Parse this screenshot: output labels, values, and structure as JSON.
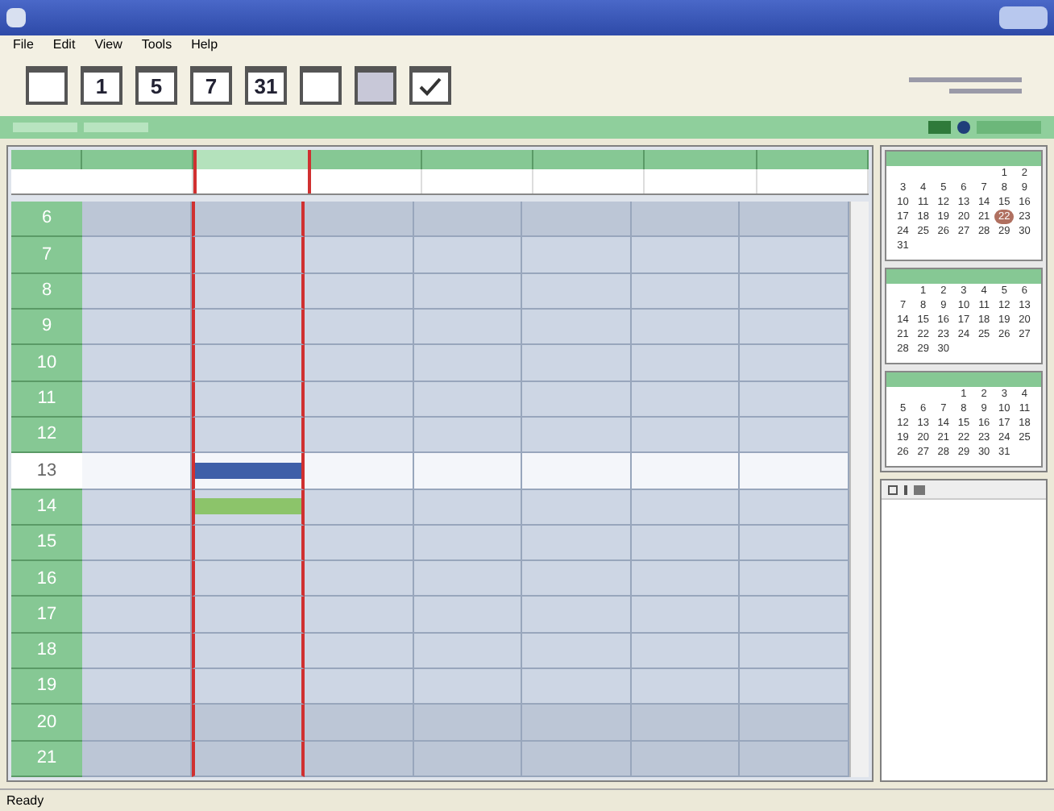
{
  "menu": [
    {
      "label": "File"
    },
    {
      "label": "Edit"
    },
    {
      "label": "View"
    },
    {
      "label": "Tools"
    },
    {
      "label": "Help"
    }
  ],
  "toolbar": [
    {
      "kind": "blank"
    },
    {
      "kind": "number",
      "label": "1"
    },
    {
      "kind": "number",
      "label": "5"
    },
    {
      "kind": "number",
      "label": "7"
    },
    {
      "kind": "number",
      "label": "31"
    },
    {
      "kind": "blank"
    },
    {
      "kind": "shaded"
    },
    {
      "kind": "check"
    }
  ],
  "day_columns": [
    {
      "selected": false
    },
    {
      "selected": true
    },
    {
      "selected": false
    },
    {
      "selected": false
    },
    {
      "selected": false
    },
    {
      "selected": false
    },
    {
      "selected": false
    }
  ],
  "hours": [
    {
      "label": "6",
      "current": false,
      "cells": [
        {
          "kind": "empty"
        },
        {
          "kind": "empty"
        },
        {
          "kind": "empty"
        },
        {
          "kind": "empty"
        },
        {
          "kind": "empty"
        },
        {
          "kind": "empty"
        },
        {
          "kind": "empty"
        }
      ]
    },
    {
      "label": "7",
      "current": false,
      "cells": [
        {
          "kind": "empty"
        },
        {
          "kind": "empty"
        },
        {
          "kind": "empty"
        },
        {
          "kind": "empty"
        },
        {
          "kind": "empty"
        },
        {
          "kind": "empty"
        },
        {
          "kind": "empty"
        }
      ]
    },
    {
      "label": "8",
      "current": false,
      "cells": [
        {
          "kind": "empty"
        },
        {
          "kind": "empty"
        },
        {
          "kind": "empty"
        },
        {
          "kind": "empty"
        },
        {
          "kind": "empty"
        },
        {
          "kind": "empty"
        },
        {
          "kind": "empty"
        }
      ]
    },
    {
      "label": "9",
      "current": false,
      "cells": [
        {
          "kind": "empty"
        },
        {
          "kind": "empty"
        },
        {
          "kind": "empty"
        },
        {
          "kind": "empty"
        },
        {
          "kind": "empty"
        },
        {
          "kind": "empty"
        },
        {
          "kind": "empty"
        }
      ]
    },
    {
      "label": "10",
      "current": false,
      "cells": [
        {
          "kind": "empty"
        },
        {
          "kind": "empty"
        },
        {
          "kind": "empty"
        },
        {
          "kind": "empty"
        },
        {
          "kind": "empty"
        },
        {
          "kind": "empty"
        },
        {
          "kind": "empty"
        }
      ]
    },
    {
      "label": "11",
      "current": false,
      "cells": [
        {
          "kind": "empty"
        },
        {
          "kind": "empty"
        },
        {
          "kind": "empty"
        },
        {
          "kind": "empty"
        },
        {
          "kind": "empty"
        },
        {
          "kind": "empty"
        },
        {
          "kind": "empty"
        }
      ]
    },
    {
      "label": "12",
      "current": false,
      "cells": [
        {
          "kind": "empty"
        },
        {
          "kind": "empty"
        },
        {
          "kind": "empty"
        },
        {
          "kind": "empty"
        },
        {
          "kind": "empty"
        },
        {
          "kind": "empty"
        },
        {
          "kind": "empty"
        }
      ]
    },
    {
      "label": "13",
      "current": true,
      "cells": [
        {
          "kind": "empty"
        },
        {
          "kind": "event",
          "color": "#3f5fa8"
        },
        {
          "kind": "empty"
        },
        {
          "kind": "empty"
        },
        {
          "kind": "empty"
        },
        {
          "kind": "empty"
        },
        {
          "kind": "empty"
        }
      ]
    },
    {
      "label": "14",
      "current": false,
      "cells": [
        {
          "kind": "empty"
        },
        {
          "kind": "event",
          "color": "#8cc46a"
        },
        {
          "kind": "empty"
        },
        {
          "kind": "empty"
        },
        {
          "kind": "empty"
        },
        {
          "kind": "empty"
        },
        {
          "kind": "empty"
        }
      ]
    },
    {
      "label": "15",
      "current": false,
      "cells": [
        {
          "kind": "empty"
        },
        {
          "kind": "empty"
        },
        {
          "kind": "empty"
        },
        {
          "kind": "empty"
        },
        {
          "kind": "empty"
        },
        {
          "kind": "empty"
        },
        {
          "kind": "empty"
        }
      ]
    },
    {
      "label": "16",
      "current": false,
      "cells": [
        {
          "kind": "empty"
        },
        {
          "kind": "empty"
        },
        {
          "kind": "empty"
        },
        {
          "kind": "empty"
        },
        {
          "kind": "empty"
        },
        {
          "kind": "empty"
        },
        {
          "kind": "empty"
        }
      ]
    },
    {
      "label": "17",
      "current": false,
      "cells": [
        {
          "kind": "empty"
        },
        {
          "kind": "empty"
        },
        {
          "kind": "empty"
        },
        {
          "kind": "empty"
        },
        {
          "kind": "empty"
        },
        {
          "kind": "empty"
        },
        {
          "kind": "empty"
        }
      ]
    },
    {
      "label": "18",
      "current": false,
      "cells": [
        {
          "kind": "empty"
        },
        {
          "kind": "empty"
        },
        {
          "kind": "empty"
        },
        {
          "kind": "empty"
        },
        {
          "kind": "empty"
        },
        {
          "kind": "empty"
        },
        {
          "kind": "empty"
        }
      ]
    },
    {
      "label": "19",
      "current": false,
      "cells": [
        {
          "kind": "empty"
        },
        {
          "kind": "empty"
        },
        {
          "kind": "empty"
        },
        {
          "kind": "empty"
        },
        {
          "kind": "empty"
        },
        {
          "kind": "empty"
        },
        {
          "kind": "empty"
        }
      ]
    },
    {
      "label": "20",
      "current": false,
      "cells": [
        {
          "kind": "empty"
        },
        {
          "kind": "empty"
        },
        {
          "kind": "empty"
        },
        {
          "kind": "empty"
        },
        {
          "kind": "empty"
        },
        {
          "kind": "empty"
        },
        {
          "kind": "empty"
        }
      ]
    },
    {
      "label": "21",
      "current": false,
      "cells": [
        {
          "kind": "empty"
        },
        {
          "kind": "empty"
        },
        {
          "kind": "empty"
        },
        {
          "kind": "empty"
        },
        {
          "kind": "empty"
        },
        {
          "kind": "empty"
        },
        {
          "kind": "empty"
        }
      ]
    }
  ],
  "mini_calendars": [
    {
      "weeks": [
        [
          {
            "kind": "blank"
          },
          {
            "kind": "blank"
          },
          {
            "kind": "blank"
          },
          {
            "kind": "blank"
          },
          {
            "kind": "blank"
          },
          {
            "kind": "day",
            "label": "1"
          },
          {
            "kind": "day",
            "label": "2"
          }
        ],
        [
          {
            "kind": "day",
            "label": "3"
          },
          {
            "kind": "day",
            "label": "4"
          },
          {
            "kind": "day",
            "label": "5"
          },
          {
            "kind": "day",
            "label": "6"
          },
          {
            "kind": "day",
            "label": "7"
          },
          {
            "kind": "day",
            "label": "8"
          },
          {
            "kind": "day",
            "label": "9"
          }
        ],
        [
          {
            "kind": "day",
            "label": "10"
          },
          {
            "kind": "day",
            "label": "11"
          },
          {
            "kind": "day",
            "label": "12"
          },
          {
            "kind": "day",
            "label": "13"
          },
          {
            "kind": "day",
            "label": "14"
          },
          {
            "kind": "day",
            "label": "15"
          },
          {
            "kind": "day",
            "label": "16"
          }
        ],
        [
          {
            "kind": "day",
            "label": "17"
          },
          {
            "kind": "day",
            "label": "18"
          },
          {
            "kind": "day",
            "label": "19"
          },
          {
            "kind": "day",
            "label": "20"
          },
          {
            "kind": "day",
            "label": "21"
          },
          {
            "kind": "today",
            "label": "22"
          },
          {
            "kind": "day",
            "label": "23"
          }
        ],
        [
          {
            "kind": "day",
            "label": "24"
          },
          {
            "kind": "day",
            "label": "25"
          },
          {
            "kind": "day",
            "label": "26"
          },
          {
            "kind": "day",
            "label": "27"
          },
          {
            "kind": "day",
            "label": "28"
          },
          {
            "kind": "day",
            "label": "29"
          },
          {
            "kind": "day",
            "label": "30"
          }
        ],
        [
          {
            "kind": "day",
            "label": "31"
          }
        ]
      ]
    },
    {
      "weeks": [
        [
          {
            "kind": "blank"
          },
          {
            "kind": "day",
            "label": "1"
          },
          {
            "kind": "day",
            "label": "2"
          },
          {
            "kind": "day",
            "label": "3"
          },
          {
            "kind": "day",
            "label": "4"
          },
          {
            "kind": "day",
            "label": "5"
          },
          {
            "kind": "day",
            "label": "6"
          }
        ],
        [
          {
            "kind": "day",
            "label": "7"
          },
          {
            "kind": "day",
            "label": "8"
          },
          {
            "kind": "day",
            "label": "9"
          },
          {
            "kind": "day",
            "label": "10"
          },
          {
            "kind": "day",
            "label": "11"
          },
          {
            "kind": "day",
            "label": "12"
          },
          {
            "kind": "day",
            "label": "13"
          }
        ],
        [
          {
            "kind": "day",
            "label": "14"
          },
          {
            "kind": "day",
            "label": "15"
          },
          {
            "kind": "day",
            "label": "16"
          },
          {
            "kind": "day",
            "label": "17"
          },
          {
            "kind": "day",
            "label": "18"
          },
          {
            "kind": "day",
            "label": "19"
          },
          {
            "kind": "day",
            "label": "20"
          }
        ],
        [
          {
            "kind": "day",
            "label": "21"
          },
          {
            "kind": "day",
            "label": "22"
          },
          {
            "kind": "day",
            "label": "23"
          },
          {
            "kind": "day",
            "label": "24"
          },
          {
            "kind": "day",
            "label": "25"
          },
          {
            "kind": "day",
            "label": "26"
          },
          {
            "kind": "day",
            "label": "27"
          }
        ],
        [
          {
            "kind": "day",
            "label": "28"
          },
          {
            "kind": "day",
            "label": "29"
          },
          {
            "kind": "day",
            "label": "30"
          }
        ]
      ]
    },
    {
      "weeks": [
        [
          {
            "kind": "blank"
          },
          {
            "kind": "blank"
          },
          {
            "kind": "blank"
          },
          {
            "kind": "day",
            "label": "1"
          },
          {
            "kind": "day",
            "label": "2"
          },
          {
            "kind": "day",
            "label": "3"
          },
          {
            "kind": "day",
            "label": "4"
          }
        ],
        [
          {
            "kind": "day",
            "label": "5"
          },
          {
            "kind": "day",
            "label": "6"
          },
          {
            "kind": "day",
            "label": "7"
          },
          {
            "kind": "day",
            "label": "8"
          },
          {
            "kind": "day",
            "label": "9"
          },
          {
            "kind": "day",
            "label": "10"
          },
          {
            "kind": "day",
            "label": "11"
          }
        ],
        [
          {
            "kind": "day",
            "label": "12"
          },
          {
            "kind": "day",
            "label": "13"
          },
          {
            "kind": "day",
            "label": "14"
          },
          {
            "kind": "day",
            "label": "15"
          },
          {
            "kind": "day",
            "label": "16"
          },
          {
            "kind": "day",
            "label": "17"
          },
          {
            "kind": "day",
            "label": "18"
          }
        ],
        [
          {
            "kind": "day",
            "label": "19"
          },
          {
            "kind": "day",
            "label": "20"
          },
          {
            "kind": "day",
            "label": "21"
          },
          {
            "kind": "day",
            "label": "22"
          },
          {
            "kind": "day",
            "label": "23"
          },
          {
            "kind": "day",
            "label": "24"
          },
          {
            "kind": "day",
            "label": "25"
          }
        ],
        [
          {
            "kind": "day",
            "label": "26"
          },
          {
            "kind": "day",
            "label": "27"
          },
          {
            "kind": "day",
            "label": "28"
          },
          {
            "kind": "day",
            "label": "29"
          },
          {
            "kind": "day",
            "label": "30"
          },
          {
            "kind": "day",
            "label": "31"
          }
        ]
      ]
    }
  ],
  "status_bar": {
    "text": "Ready"
  }
}
